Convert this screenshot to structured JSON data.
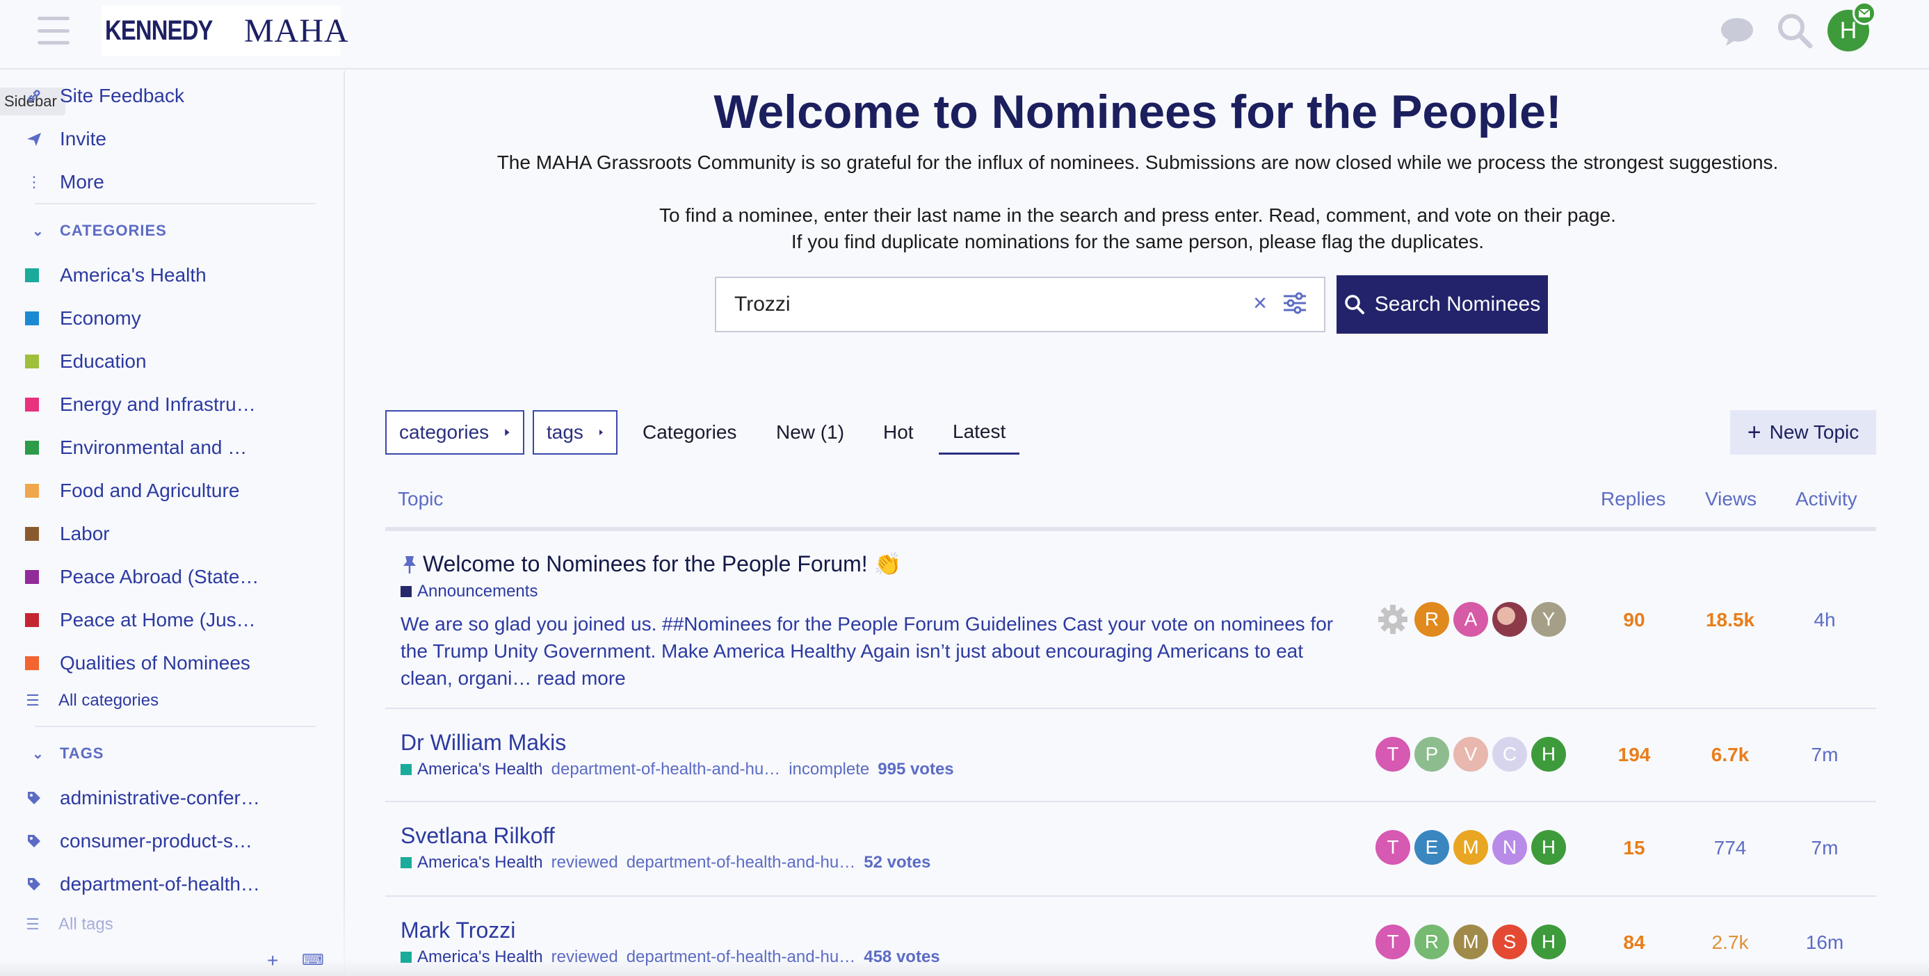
{
  "header": {
    "logo_left": "KENNEDY",
    "logo_right": "MAHA",
    "avatar_letter": "H"
  },
  "sidebar": {
    "tooltip": "Sidebar",
    "top_items": [
      {
        "label": "Site Feedback",
        "icon": "link-icon"
      },
      {
        "label": "Invite",
        "icon": "paper-plane-icon"
      },
      {
        "label": "More",
        "icon": "ellipsis-vertical-icon"
      }
    ],
    "categories_heading": "CATEGORIES",
    "categories": [
      {
        "label": "America's Health",
        "color": "#1aab9b"
      },
      {
        "label": "Economy",
        "color": "#1c8ad3"
      },
      {
        "label": "Education",
        "color": "#a0c03c"
      },
      {
        "label": "Energy and Infrastru…",
        "color": "#e8327c"
      },
      {
        "label": "Environmental and …",
        "color": "#2d9b48"
      },
      {
        "label": "Food and Agriculture",
        "color": "#f0a64a"
      },
      {
        "label": "Labor",
        "color": "#8a5a2f"
      },
      {
        "label": "Peace Abroad (State…",
        "color": "#922a9a"
      },
      {
        "label": "Peace at Home (Jus…",
        "color": "#c52533"
      },
      {
        "label": "Qualities of Nominees",
        "color": "#f26430"
      }
    ],
    "all_categories": "All categories",
    "tags_heading": "TAGS",
    "tags": [
      {
        "label": "administrative-confer…"
      },
      {
        "label": "consumer-product-s…"
      },
      {
        "label": "department-of-health…"
      }
    ],
    "all_tags": "All tags"
  },
  "welcome": {
    "title": "Welcome to Nominees for the People!",
    "line1": "The MAHA Grassroots Community is so grateful for the influx of nominees. Submissions are now closed while we process the strongest suggestions.",
    "line2": "To find a nominee, enter their last name in the search and press enter. Read, comment, and vote on their page.",
    "line3": "If you find duplicate nominations for the same person, please flag the duplicates."
  },
  "search": {
    "value": "Trozzi",
    "button_label": "Search Nominees"
  },
  "nav": {
    "categories_dropdown": "categories",
    "tags_dropdown": "tags",
    "tabs": [
      "Categories",
      "New (1)",
      "Hot",
      "Latest"
    ],
    "active_tab": "Latest",
    "new_topic_label": "New Topic"
  },
  "table": {
    "headers": {
      "topic": "Topic",
      "replies": "Replies",
      "views": "Views",
      "activity": "Activity"
    },
    "rows": [
      {
        "title": "Welcome to Nominees for the People Forum! 👏",
        "pinned": true,
        "category": "Announcements",
        "category_color": "#25286b",
        "excerpt": "We are so glad you joined us. ##Nominees for the People Forum Guidelines Cast your vote on nominees for the Trump Unity Government. Make America Healthy Again isn’t just about encouraging Americans to eat clean, organi…",
        "read_more": "read more",
        "posters": [
          {
            "letter": "",
            "color": "#c4c4c4",
            "icon": "gear-icon"
          },
          {
            "letter": "R",
            "color": "#e08a1e"
          },
          {
            "letter": "A",
            "color": "#d65aa6"
          },
          {
            "letter": "",
            "color": "#8c3a4a",
            "icon": "photo-avatar"
          },
          {
            "letter": "Y",
            "color": "#a59f87"
          }
        ],
        "replies": "90",
        "views": "18.5k",
        "views_color": "#e87e1a",
        "views_bold": true,
        "activity": "4h"
      },
      {
        "title": "Dr William Makis",
        "category": "America's Health",
        "category_color": "#1aab9b",
        "tags": [
          "department-of-health-and-hu…",
          "incomplete"
        ],
        "votes": "995 votes",
        "posters": [
          {
            "letter": "T",
            "color": "#d659b2"
          },
          {
            "letter": "P",
            "color": "#8dbd8f"
          },
          {
            "letter": "V",
            "color": "#e8b7ad"
          },
          {
            "letter": "C",
            "color": "#d7d5ee"
          },
          {
            "letter": "H",
            "color": "#3e9b3b"
          }
        ],
        "replies": "194",
        "views": "6.7k",
        "views_color": "#e87e1a",
        "views_bold": true,
        "activity": "7m"
      },
      {
        "title": "Svetlana Rilkoff",
        "category": "America's Health",
        "category_color": "#1aab9b",
        "tags": [
          "reviewed",
          "department-of-health-and-hu…"
        ],
        "votes": "52 votes",
        "posters": [
          {
            "letter": "T",
            "color": "#d659b2"
          },
          {
            "letter": "E",
            "color": "#3a87c0"
          },
          {
            "letter": "M",
            "color": "#e8a623"
          },
          {
            "letter": "N",
            "color": "#b98be8"
          },
          {
            "letter": "H",
            "color": "#3e9b3b"
          }
        ],
        "replies": "15",
        "views": "774",
        "views_color": "#5c6cc4",
        "views_bold": false,
        "activity": "7m"
      },
      {
        "title": "Mark Trozzi",
        "category": "America's Health",
        "category_color": "#1aab9b",
        "tags": [
          "reviewed",
          "department-of-health-and-hu…"
        ],
        "votes": "458 votes",
        "posters": [
          {
            "letter": "T",
            "color": "#d659b2"
          },
          {
            "letter": "R",
            "color": "#76b971"
          },
          {
            "letter": "M",
            "color": "#a08a4a"
          },
          {
            "letter": "S",
            "color": "#e44a33"
          },
          {
            "letter": "H",
            "color": "#3e9b3b"
          }
        ],
        "replies": "84",
        "views": "2.7k",
        "views_color": "#e0913a",
        "views_bold": false,
        "activity": "16m"
      }
    ]
  }
}
